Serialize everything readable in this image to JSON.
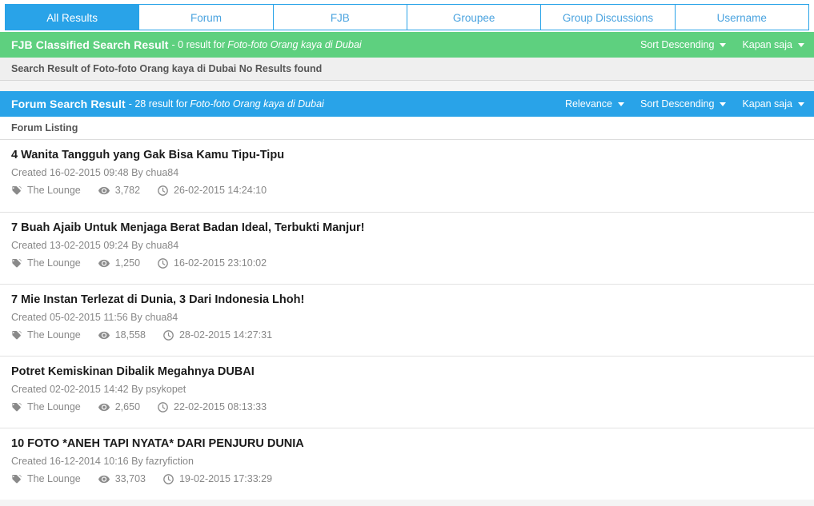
{
  "tabs": [
    {
      "label": "All Results",
      "active": true
    },
    {
      "label": "Forum",
      "active": false
    },
    {
      "label": "FJB",
      "active": false
    },
    {
      "label": "Groupee",
      "active": false
    },
    {
      "label": "Group Discussions",
      "active": false
    },
    {
      "label": "Username",
      "active": false
    }
  ],
  "colors": {
    "accent_blue": "#29a3e8",
    "accent_green": "#5ed07f",
    "page_bg": "#f4f4f4",
    "strip_bg": "#efefef",
    "title_text": "#1b1b1b",
    "meta_text": "#878787"
  },
  "fjb_section": {
    "title": "FJB Classified Search Result",
    "meta": "- 0 result for",
    "query": "Foto-foto Orang kaya di Dubai",
    "dropdowns": [
      {
        "label": "Sort Descending",
        "icon": "chevron-down-icon"
      },
      {
        "label": "Kapan saja",
        "icon": "chevron-down-icon"
      }
    ],
    "empty_message": "Search Result of Foto-foto Orang kaya di Dubai No Results found"
  },
  "forum_section": {
    "title": "Forum Search Result",
    "meta": "- 28 result for",
    "query": "Foto-foto Orang kaya di Dubai",
    "dropdowns": [
      {
        "label": "Relevance",
        "icon": "chevron-down-icon"
      },
      {
        "label": "Sort Descending",
        "icon": "chevron-down-icon"
      },
      {
        "label": "Kapan saja",
        "icon": "chevron-down-icon"
      }
    ],
    "listing_label": "Forum Listing",
    "results": [
      {
        "title": "4 Wanita Tangguh yang Gak Bisa Kamu Tipu-Tipu",
        "created": "Created 16-02-2015 09:48 By chua84",
        "forum": "The Lounge",
        "views": "3,782",
        "last_post": "26-02-2015 14:24:10"
      },
      {
        "title": "7 Buah Ajaib Untuk Menjaga Berat Badan Ideal, Terbukti Manjur!",
        "created": "Created 13-02-2015 09:24 By chua84",
        "forum": "The Lounge",
        "views": "1,250",
        "last_post": "16-02-2015 23:10:02"
      },
      {
        "title": "7 Mie Instan Terlezat di Dunia, 3 Dari Indonesia Lhoh!",
        "created": "Created 05-02-2015 11:56 By chua84",
        "forum": "The Lounge",
        "views": "18,558",
        "last_post": "28-02-2015 14:27:31"
      },
      {
        "title": "Potret Kemiskinan Dibalik Megahnya DUBAI",
        "created": "Created 02-02-2015 14:42 By psykopet",
        "forum": "The Lounge",
        "views": "2,650",
        "last_post": "22-02-2015 08:13:33"
      },
      {
        "title": "10 FOTO *ANEH TAPI NYATA* DARI PENJURU DUNIA",
        "created": "Created 16-12-2014 10:16 By fazryfiction",
        "forum": "The Lounge",
        "views": "33,703",
        "last_post": "19-02-2015 17:33:29"
      }
    ],
    "icons": {
      "forum": "tag-icon",
      "views": "eye-icon",
      "last_post": "clock-icon"
    }
  }
}
